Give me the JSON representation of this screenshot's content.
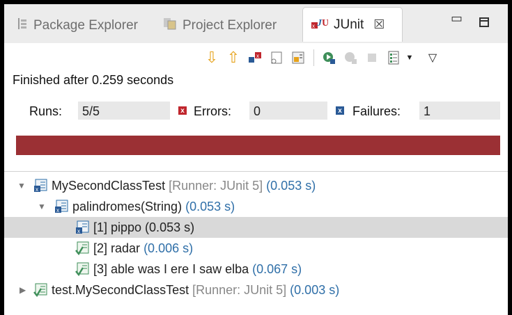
{
  "tabs": [
    {
      "label": "Package Explorer"
    },
    {
      "label": "Project Explorer"
    },
    {
      "label": "JUnit"
    }
  ],
  "status": "Finished after 0.259 seconds",
  "counters": {
    "runs_label": "Runs:",
    "runs_value": "5/5",
    "errors_label": "Errors:",
    "errors_value": "0",
    "failures_label": "Failures:",
    "failures_value": "1"
  },
  "progress": {
    "fraction": 1.0,
    "color": "#9b3034"
  },
  "tree": [
    {
      "name": "MySecondClassTest",
      "runner": "[Runner: JUnit 5]",
      "time": "(0.053 s)",
      "status": "failure",
      "expanded": true
    },
    {
      "name": "palindromes(String)",
      "runner": "",
      "time": "(0.053 s)",
      "status": "failure",
      "expanded": true
    },
    {
      "name": "[1] pippo (0.053 s)",
      "runner": "",
      "time": "",
      "status": "failure"
    },
    {
      "name": "[2] radar",
      "runner": "",
      "time": "(0.006 s)",
      "status": "passed"
    },
    {
      "name": "[3] able was I ere I saw elba",
      "runner": "",
      "time": "(0.067 s)",
      "status": "passed"
    },
    {
      "name": "test.MySecondClassTest",
      "runner": "[Runner: JUnit 5]",
      "time": "(0.003 s)",
      "status": "passed",
      "expanded": false
    }
  ],
  "toolbar_icons": [
    "next-failure-icon",
    "previous-failure-icon",
    "show-failures-only-icon",
    "scroll-lock-icon",
    "show-skipped-icon",
    "rerun-icon",
    "rerun-failed-first-icon",
    "stop-icon",
    "history-icon",
    "view-menu-icon"
  ]
}
